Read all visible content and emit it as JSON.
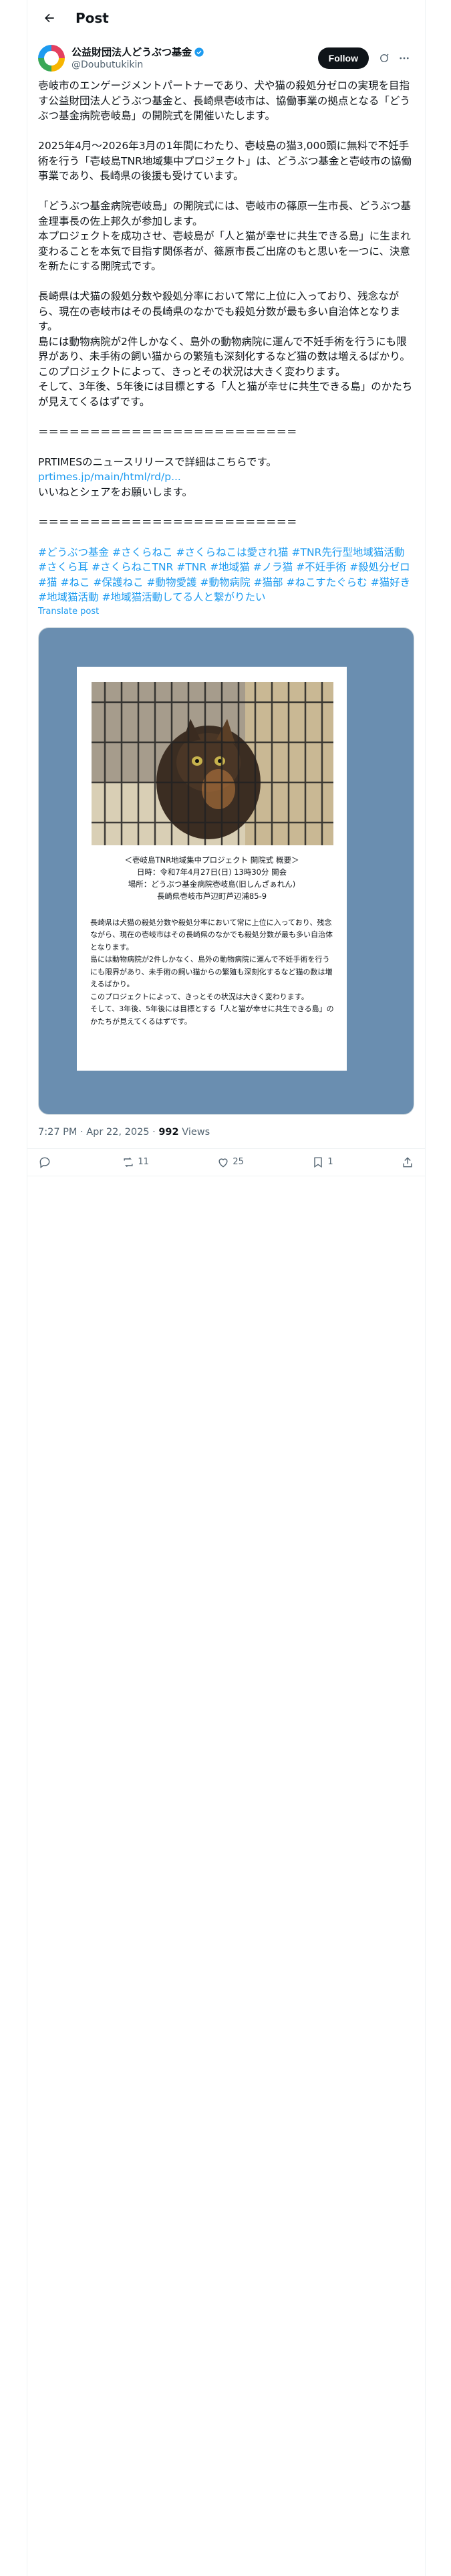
{
  "header": {
    "title": "Post"
  },
  "author": {
    "name": "公益財団法人どうぶつ基金",
    "handle": "@Doubutukikin",
    "follow_label": "Follow"
  },
  "post": {
    "paragraphs": [
      "壱岐市のエンゲージメントパートナーであり、犬や猫の殺処分ゼロの実現を目指す公益財団法人どうぶつ基金と、長崎県壱岐市は、協働事業の拠点となる「どうぶつ基金病院壱岐島」の開院式を開催いたします。",
      "2025年4月〜2026年3月の1年間にわたり、壱岐島の猫3,000頭に無料で不妊手術を行う「壱岐島TNR地域集中プロジェクト」は、どうぶつ基金と壱岐市の協働事業であり、長崎県の後援も受けています。",
      "「どうぶつ基金病院壱岐島」の開院式には、壱岐市の篠原一生市長、どうぶつ基金理事長の佐上邦久が参加します。\n本プロジェクトを成功させ、壱岐島が「人と猫が幸せに共生できる島」に生まれ変わることを本気で目指す関係者が、篠原市長ご出席のもと思いを一つに、決意を新たにする開院式です。",
      "長崎県は犬猫の殺処分数や殺処分率において常に上位に入っており、残念ながら、現在の壱岐市はその長崎県のなかでも殺処分数が最も多い自治体となります。\n島には動物病院が2件しかなく、島外の動物病院に運んで不妊手術を行うにも限界があり、未手術の飼い猫からの繁殖も深刻化するなど猫の数は増えるばかり。\nこのプロジェクトによって、きっとその状況は大きく変わります。\nそして、3年後、5年後には目標とする「人と猫が幸せに共生できる島」のかたちが見えてくるはずです。",
      "＝＝＝＝＝＝＝＝＝＝＝＝＝＝＝＝＝＝＝＝＝＝＝＝＝"
    ],
    "pr_text": "PRTIMESのニュースリリースで詳細はこちらです。",
    "pr_link": "prtimes.jp/main/html/rd/p...",
    "share_text": "いいねとシェアをお願いします。",
    "divider": "＝＝＝＝＝＝＝＝＝＝＝＝＝＝＝＝＝＝＝＝＝＝＝＝＝",
    "hashtags": [
      "#どうぶつ基金",
      "#さくらねこ",
      "#さくらねこは愛され猫",
      "#TNR先行型地域猫活動",
      "#さくら耳",
      "#さくらねこTNR",
      "#TNR",
      "#地域猫",
      "#ノラ猫",
      "#不妊手術",
      "#殺処分ゼロ",
      "#猫",
      "#ねこ",
      "#保護ねこ",
      "#動物愛護",
      "#動物病院",
      "#猫部",
      "#ねこすたぐらむ",
      "#猫好き",
      "#地域猫活動",
      "#地域猫活動してる人と繋がりたい"
    ],
    "translate": "Translate post"
  },
  "flyer": {
    "title": "＜壱岐島TNR地域集中プロジェクト 開院式 概要＞",
    "date": "日時：令和7年4月27日(日) 13時30分 開会",
    "place": "場所：どうぶつ基金病院壱岐島(旧しんざぁれん)",
    "address": "長崎県壱岐市芦辺町芦辺浦85-9",
    "body": "長崎県は犬猫の殺処分数や殺処分率において常に上位に入っており、残念ながら、現在の壱岐市はその長崎県のなかでも殺処分数が最も多い自治体となります。\n島には動物病院が2件しかなく、島外の動物病院に運んで不妊手術を行うにも限界があり、未手術の飼い猫からの繁殖も深刻化するなど猫の数は増えるばかり。\nこのプロジェクトによって、きっとその状況は大きく変わります。\nそして、3年後、5年後には目標とする「人と猫が幸せに共生できる島」のかたちが見えてくるはずです。"
  },
  "meta": {
    "time": "7:27 PM · Apr 22, 2025 · ",
    "views_count": "992",
    "views_label": " Views"
  },
  "actions": {
    "replies": "",
    "reposts": "11",
    "likes": "25",
    "bookmarks": "1"
  },
  "colors": {
    "accent": "#1d9bf0",
    "media_bg": "#6a8eb0",
    "text": "#0f1419",
    "muted": "#536471"
  }
}
